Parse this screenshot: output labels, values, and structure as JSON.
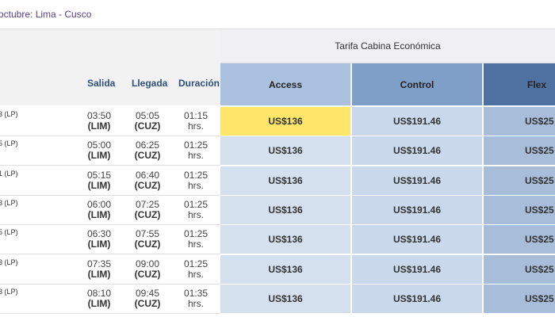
{
  "route": "octubre: Lima - Cusco",
  "fare_group_title": "Tarifa Cabina Económica",
  "columns": {
    "salida": "Salida",
    "llegada": "Llegada",
    "duracion": "Duración"
  },
  "fares": {
    "access": "Access",
    "control": "Control",
    "flex": "Flex"
  },
  "flights": [
    {
      "code": "3 (LP)",
      "dep": "03:50",
      "dep_ap": "(LIM)",
      "arr": "05:05",
      "arr_ap": "(CUZ)",
      "dur": "01:15",
      "dur_unit": "hrs.",
      "access": "US$136",
      "control": "US$191.46",
      "flex": "US$25",
      "selected": "access"
    },
    {
      "code": "5 (LP)",
      "dep": "05:00",
      "dep_ap": "(LIM)",
      "arr": "06:25",
      "arr_ap": "(CUZ)",
      "dur": "01:25",
      "dur_unit": "hrs.",
      "access": "US$136",
      "control": "US$191.46",
      "flex": "US$25"
    },
    {
      "code": "1 (LP)",
      "dep": "05:15",
      "dep_ap": "(LIM)",
      "arr": "06:40",
      "arr_ap": "(CUZ)",
      "dur": "01:25",
      "dur_unit": "hrs.",
      "access": "US$136",
      "control": "US$191.46",
      "flex": "US$25"
    },
    {
      "code": "3 (LP)",
      "dep": "06:00",
      "dep_ap": "(LIM)",
      "arr": "07:25",
      "arr_ap": "(CUZ)",
      "dur": "01:25",
      "dur_unit": "hrs.",
      "access": "US$136",
      "control": "US$191.46",
      "flex": "US$25"
    },
    {
      "code": "5 (LP)",
      "dep": "06:30",
      "dep_ap": "(LIM)",
      "arr": "07:55",
      "arr_ap": "(CUZ)",
      "dur": "01:25",
      "dur_unit": "hrs.",
      "access": "US$136",
      "control": "US$191.46",
      "flex": "US$25"
    },
    {
      "code": "3 (LP)",
      "dep": "07:35",
      "dep_ap": "(LIM)",
      "arr": "09:00",
      "arr_ap": "(CUZ)",
      "dur": "01:25",
      "dur_unit": "hrs.",
      "access": "US$136",
      "control": "US$191.46",
      "flex": "US$25"
    },
    {
      "code": "3 (LP)",
      "dep": "08:10",
      "dep_ap": "(LIM)",
      "arr": "09:45",
      "arr_ap": "(CUZ)",
      "dur": "01:35",
      "dur_unit": "hrs.",
      "access": "US$136",
      "control": "US$191.46",
      "flex": "US$25"
    }
  ]
}
